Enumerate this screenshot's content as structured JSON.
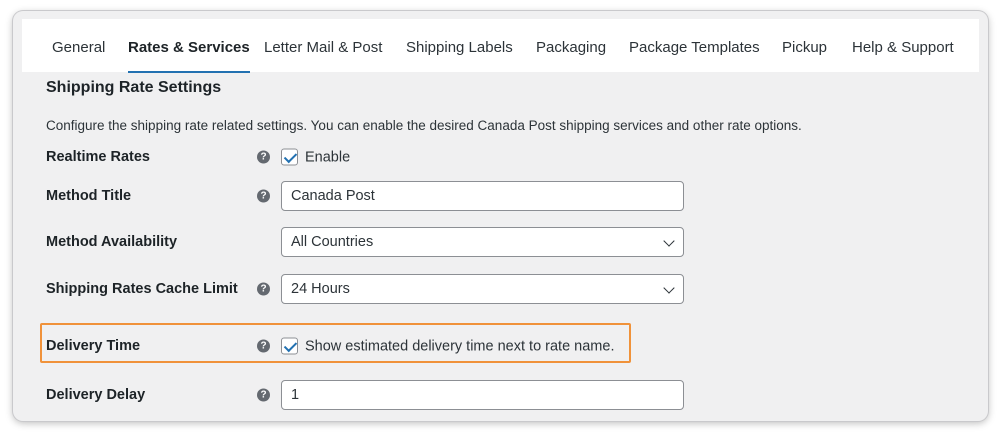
{
  "tabs": [
    {
      "label": "General"
    },
    {
      "label": "Rates & Services",
      "active": true
    },
    {
      "label": "Letter Mail & Post"
    },
    {
      "label": "Shipping Labels"
    },
    {
      "label": "Packaging"
    },
    {
      "label": "Package Templates"
    },
    {
      "label": "Pickup"
    },
    {
      "label": "Help & Support"
    }
  ],
  "section": {
    "title": "Shipping Rate Settings",
    "description": "Configure the shipping rate related settings. You can enable the desired Canada Post shipping services and other rate options."
  },
  "fields": {
    "realtime_rates": {
      "label": "Realtime Rates",
      "checkbox_label": "Enable",
      "checked": true
    },
    "method_title": {
      "label": "Method Title",
      "value": "Canada Post"
    },
    "method_availability": {
      "label": "Method Availability",
      "value": "All Countries"
    },
    "cache_limit": {
      "label": "Shipping Rates Cache Limit",
      "value": "24 Hours"
    },
    "delivery_time": {
      "label": "Delivery Time",
      "checkbox_label": "Show estimated delivery time next to rate name.",
      "checked": true
    },
    "delivery_delay": {
      "label": "Delivery Delay",
      "value": "1"
    }
  },
  "help_glyph": "?",
  "colors": {
    "accent": "#2271b1",
    "highlight_border": "#f0923a",
    "panel_background": "#f0f0f1"
  }
}
